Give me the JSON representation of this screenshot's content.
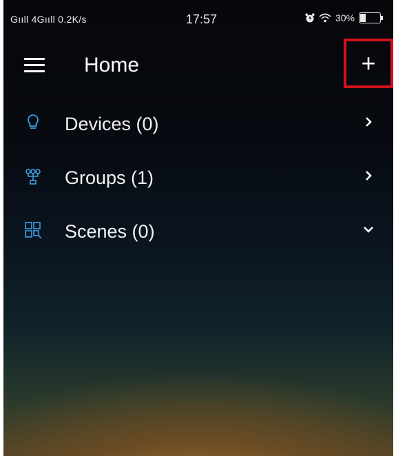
{
  "status_bar": {
    "network": "Gııll 4Gııll 0.2K/s",
    "time": "17:57",
    "battery": "30%"
  },
  "appbar": {
    "title": "Home",
    "add_label": "+"
  },
  "menu": [
    {
      "label": "Devices (0)",
      "icon": "lightbulb-icon",
      "chevron": "chevron-right-icon"
    },
    {
      "label": "Groups (1)",
      "icon": "groups-icon",
      "chevron": "chevron-right-icon"
    },
    {
      "label": "Scenes (0)",
      "icon": "scenes-icon",
      "chevron": "chevron-down-icon"
    }
  ],
  "colors": {
    "accent_icon": "#3aa0e8",
    "highlight": "#d3101d"
  }
}
